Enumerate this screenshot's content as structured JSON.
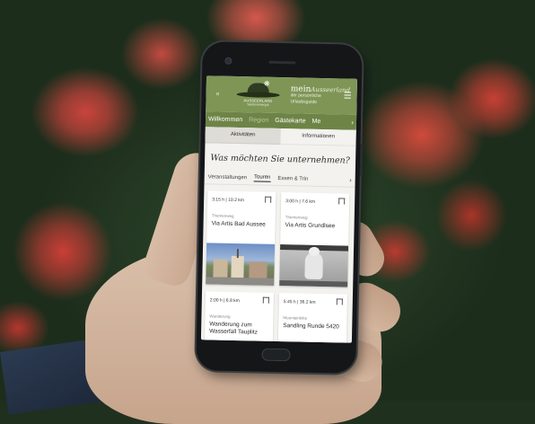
{
  "app": {
    "logo_name": "Ausseerland",
    "logo_subtitle": "Salzkammergut",
    "brand_main": "mein",
    "brand_script": "Ausseerland",
    "brand_sub_1": "der persönliche",
    "brand_sub_2": "Urlaubsguide",
    "icons": {
      "chat": "chat-icon",
      "menu": "menu-icon",
      "logo": "hat-flower-logo"
    },
    "accent_color": "#7e9556",
    "nav_color": "#6d8446"
  },
  "nav": {
    "items": [
      "Willkommen",
      "Region",
      "Gästekarte",
      "Me"
    ],
    "active": "Region",
    "more": "›"
  },
  "segments": {
    "items": [
      "Aktivitäten",
      "Informationen"
    ],
    "active": "Aktivitäten"
  },
  "headline": "Was möchten Sie unternehmen?",
  "categories": {
    "items": [
      "Veranstaltungen",
      "Touren",
      "Essen & Trin"
    ],
    "active": "Touren",
    "more": "›"
  },
  "cards": [
    {
      "meta": "3:15 h | 10.2 km",
      "category": "Themenweg",
      "title": "Via Artis Bad Aussee",
      "image": "town-street-photo"
    },
    {
      "meta": "3:00 h | 7.6 km",
      "category": "Themenweg",
      "title": "Via Artis Grundlsee",
      "image": "black-white-statue-photo"
    },
    {
      "meta": "2:00 h | 6.8 km",
      "category": "Wanderung",
      "title": "Wanderung zum Wasserfall Tauplitz",
      "image": ""
    },
    {
      "meta": "5:45 h | 36.2 km",
      "category": "Mountainbike",
      "title": "Sandling Runde 5420",
      "image": ""
    }
  ]
}
